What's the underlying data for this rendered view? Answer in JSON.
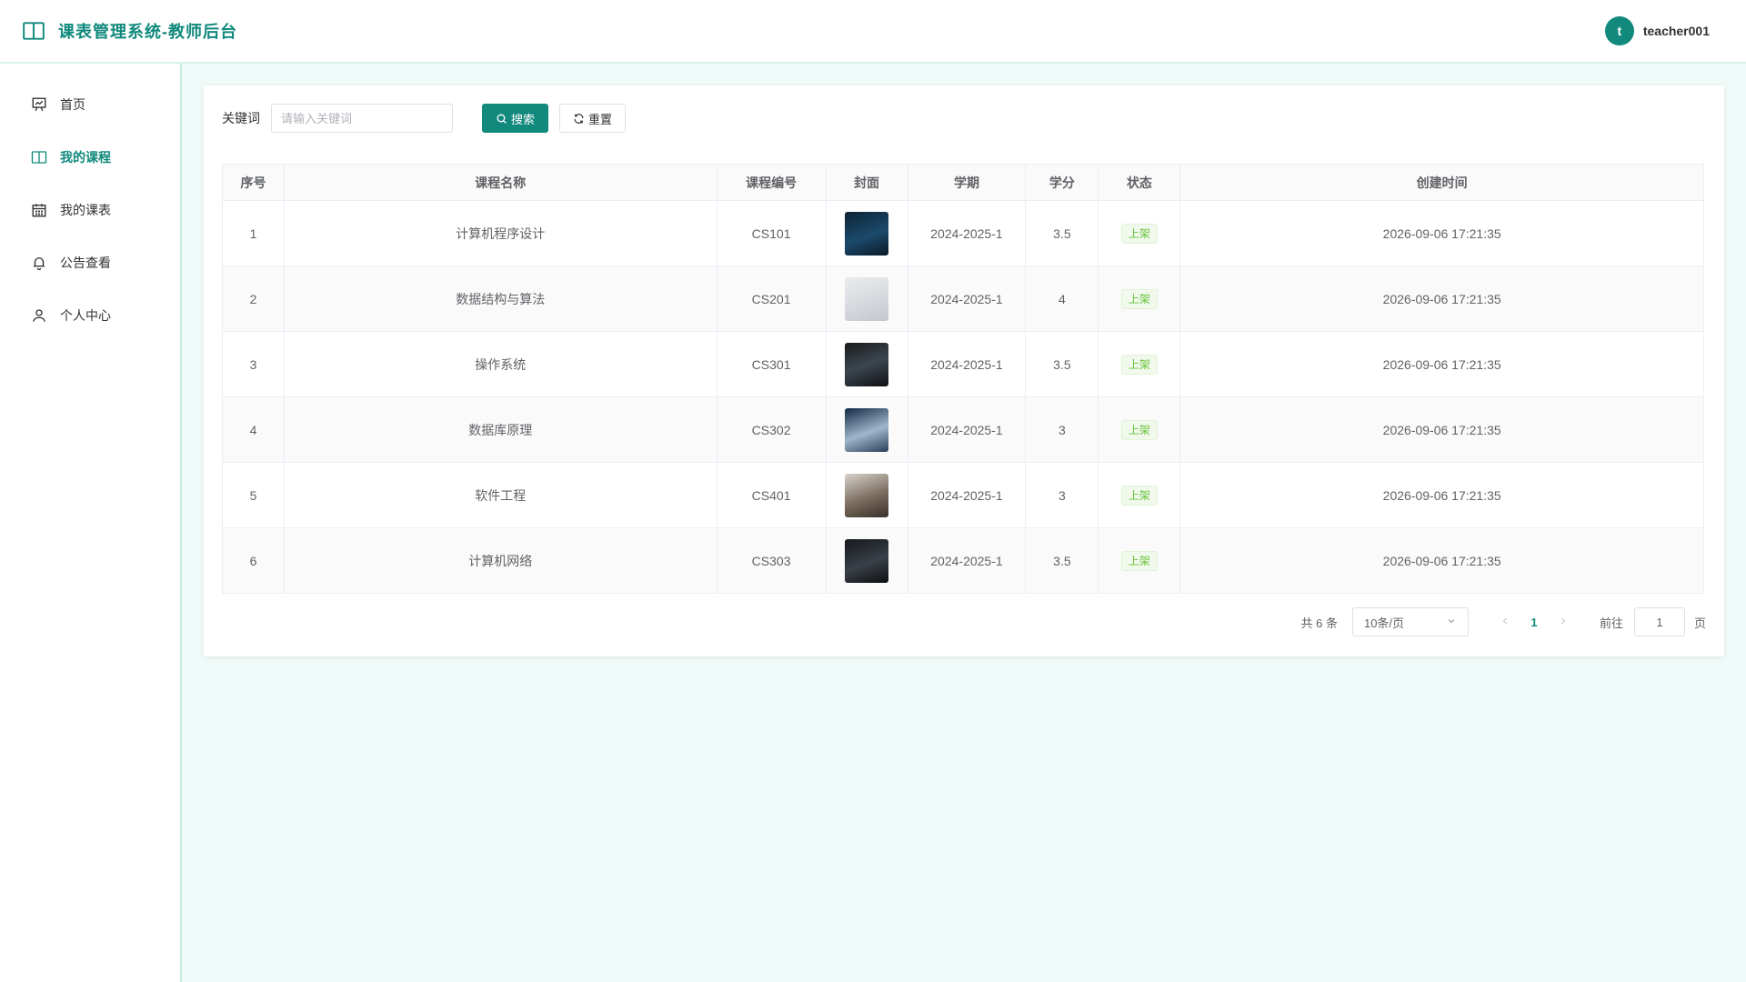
{
  "header": {
    "title": "课表管理系统-教师后台",
    "user": {
      "initial": "t",
      "name": "teacher001"
    }
  },
  "sidebar": {
    "items": [
      {
        "label": "首页",
        "icon": "presentation-icon",
        "active": false
      },
      {
        "label": "我的课程",
        "icon": "book-icon",
        "active": true
      },
      {
        "label": "我的课表",
        "icon": "calendar-icon",
        "active": false
      },
      {
        "label": "公告查看",
        "icon": "bell-icon",
        "active": false
      },
      {
        "label": "个人中心",
        "icon": "user-icon",
        "active": false
      }
    ]
  },
  "search": {
    "label": "关键词",
    "placeholder": "请输入关键词",
    "value": "",
    "search_label": "搜索",
    "reset_label": "重置"
  },
  "table": {
    "columns": [
      "序号",
      "课程名称",
      "课程编号",
      "封面",
      "学期",
      "学分",
      "状态",
      "创建时间"
    ],
    "rows": [
      {
        "no": "1",
        "name": "计算机程序设计",
        "code": "CS101",
        "term": "2024-2025-1",
        "credit": "3.5",
        "status": "上架",
        "created": "2026-09-06 17:21:35"
      },
      {
        "no": "2",
        "name": "数据结构与算法",
        "code": "CS201",
        "term": "2024-2025-1",
        "credit": "4",
        "status": "上架",
        "created": "2026-09-06 17:21:35"
      },
      {
        "no": "3",
        "name": "操作系统",
        "code": "CS301",
        "term": "2024-2025-1",
        "credit": "3.5",
        "status": "上架",
        "created": "2026-09-06 17:21:35"
      },
      {
        "no": "4",
        "name": "数据库原理",
        "code": "CS302",
        "term": "2024-2025-1",
        "credit": "3",
        "status": "上架",
        "created": "2026-09-06 17:21:35"
      },
      {
        "no": "5",
        "name": "软件工程",
        "code": "CS401",
        "term": "2024-2025-1",
        "credit": "3",
        "status": "上架",
        "created": "2026-09-06 17:21:35"
      },
      {
        "no": "6",
        "name": "计算机网络",
        "code": "CS303",
        "term": "2024-2025-1",
        "credit": "3.5",
        "status": "上架",
        "created": "2026-09-06 17:21:35"
      }
    ]
  },
  "pagination": {
    "total": "共 6 条",
    "page_size": "10条/页",
    "current_page": "1",
    "goto_label": "前往",
    "goto_value": "1",
    "page_suffix": "页"
  },
  "colors": {
    "accent": "#11897d",
    "status_text": "#67c23a",
    "status_bg": "#f0f9eb"
  }
}
